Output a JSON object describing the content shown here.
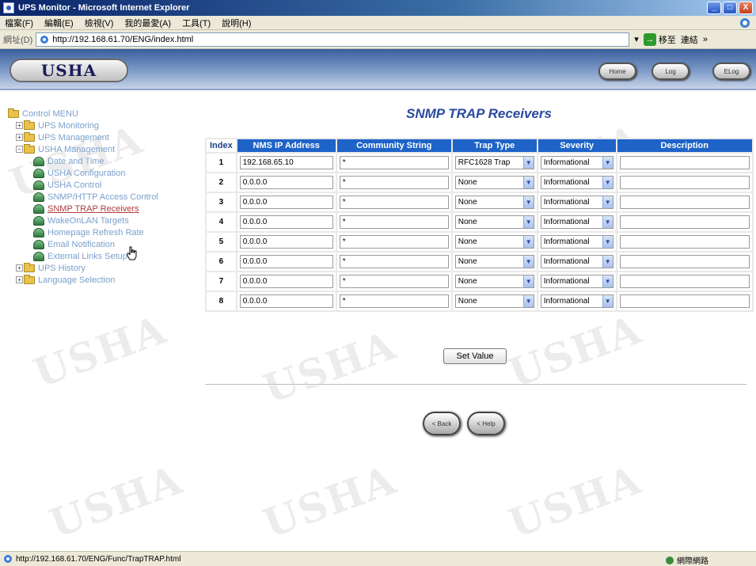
{
  "window": {
    "title": "UPS Monitor - Microsoft Internet Explorer",
    "buttons": {
      "minimize": "_",
      "maximize": "□",
      "close": "X"
    }
  },
  "menubar": {
    "items": [
      "檔案(F)",
      "編輯(E)",
      "檢視(V)",
      "我的最愛(A)",
      "工具(T)",
      "說明(H)"
    ]
  },
  "address": {
    "label": "網址(D)",
    "url": "http://192.168.61.70/ENG/index.html",
    "go_label": "移至",
    "links_label": "連結"
  },
  "header": {
    "logo": "USHA",
    "buttons": [
      "Home",
      "Log",
      "ELog"
    ]
  },
  "sidebar": {
    "root": "Control MENU",
    "items": [
      {
        "label": "UPS Monitoring",
        "level": 1,
        "type": "folder",
        "expandable": true
      },
      {
        "label": "UPS Management",
        "level": 1,
        "type": "folder",
        "expandable": true
      },
      {
        "label": "USHA Management",
        "level": 1,
        "type": "folder",
        "expandable": true
      },
      {
        "label": "Date and Time",
        "level": 2,
        "type": "page"
      },
      {
        "label": "USHA Configuration",
        "level": 2,
        "type": "page"
      },
      {
        "label": "USHA Control",
        "level": 2,
        "type": "page"
      },
      {
        "label": "SNMP/HTTP Access Control",
        "level": 2,
        "type": "page"
      },
      {
        "label": "SNMP TRAP Receivers",
        "level": 2,
        "type": "page",
        "active": true
      },
      {
        "label": "WakeOnLAN Targets",
        "level": 2,
        "type": "page"
      },
      {
        "label": "Homepage Refresh Rate",
        "level": 2,
        "type": "page"
      },
      {
        "label": "Email Notification",
        "level": 2,
        "type": "page"
      },
      {
        "label": "External Links Setup",
        "level": 2,
        "type": "page"
      },
      {
        "label": "UPS History",
        "level": 1,
        "type": "folder",
        "expandable": true
      },
      {
        "label": "Language Selection",
        "level": 1,
        "type": "folder",
        "expandable": true
      }
    ]
  },
  "main": {
    "title": "SNMP TRAP Receivers",
    "columns": [
      "Index",
      "NMS IP Address",
      "Community String",
      "Trap Type",
      "Severity",
      "Description"
    ],
    "rows": [
      {
        "index": "1",
        "ip": "192.168.65.10",
        "community": "*",
        "trap": "RFC1628 Trap",
        "severity": "Informational",
        "description": ""
      },
      {
        "index": "2",
        "ip": "0.0.0.0",
        "community": "*",
        "trap": "None",
        "severity": "Informational",
        "description": ""
      },
      {
        "index": "3",
        "ip": "0.0.0.0",
        "community": "*",
        "trap": "None",
        "severity": "Informational",
        "description": ""
      },
      {
        "index": "4",
        "ip": "0.0.0.0",
        "community": "*",
        "trap": "None",
        "severity": "Informational",
        "description": ""
      },
      {
        "index": "5",
        "ip": "0.0.0.0",
        "community": "*",
        "trap": "None",
        "severity": "Informational",
        "description": ""
      },
      {
        "index": "6",
        "ip": "0.0.0.0",
        "community": "*",
        "trap": "None",
        "severity": "Informational",
        "description": ""
      },
      {
        "index": "7",
        "ip": "0.0.0.0",
        "community": "*",
        "trap": "None",
        "severity": "Informational",
        "description": ""
      },
      {
        "index": "8",
        "ip": "0.0.0.0",
        "community": "*",
        "trap": "None",
        "severity": "Informational",
        "description": ""
      }
    ],
    "set_button": "Set Value",
    "nav_buttons": [
      "< Back",
      "< Help"
    ]
  },
  "statusbar": {
    "url": "http://192.168.61.70/ENG/Func/TrapTRAP.html",
    "zone": "網際網路"
  },
  "colors": {
    "header_blue": "#1e63c8",
    "title_blue": "#2a4aa0",
    "tree_link": "#7aa0cc",
    "active_link": "#b23a3a"
  }
}
